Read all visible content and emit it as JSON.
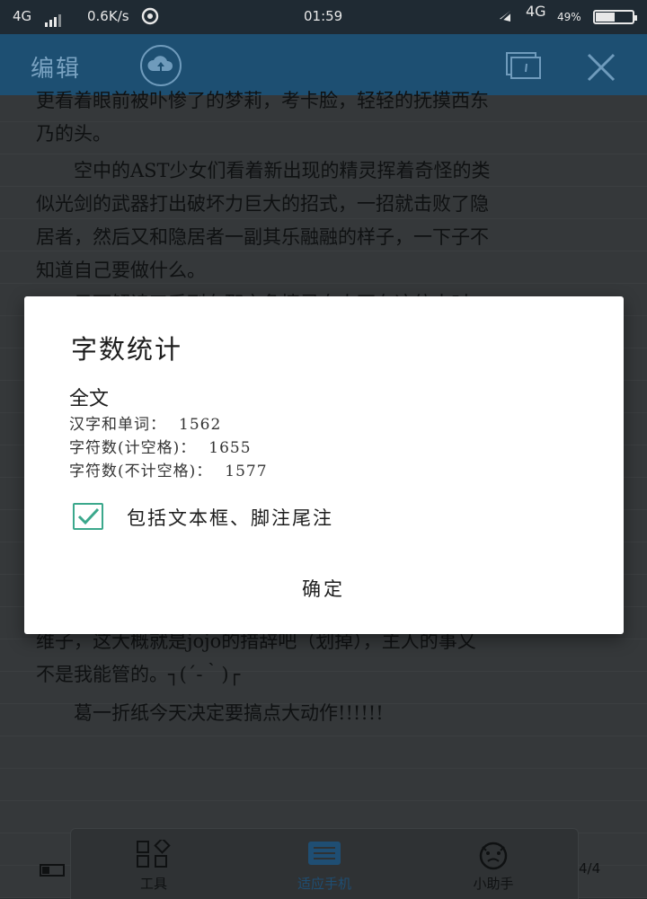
{
  "status_bar": {
    "network_left": "4G",
    "speed": "0.6K/s",
    "time": "01:59",
    "network_right": "4G",
    "battery_text": "49%",
    "battery_level": 0.49
  },
  "app_bar": {
    "title": "编辑",
    "icons": [
      "cloud-upload-icon",
      "duplicate-icon",
      "close-icon"
    ]
  },
  "document": {
    "lines_before": [
      "更看着眼前被卟惨了的梦莉，考卡脸，轻轻的抚摸西东",
      "乃的头。"
    ],
    "paragraph1": [
      "空中的AST少女们看着新出现的精灵挥着奇怪的类",
      "似光剑的武器打出破坏力巨大的招式，一招就击败了隐",
      "居者，然后又和隐居者一副其乐融融的样子，一下子不",
      "知道自己要做什么。"
    ],
    "paragraph1b": "只可解读了系列在那之角情灵自人不在这仿大时",
    "lines_after": [
      "维子，这大概就是jojo的措辞吧（划掉），主人的事又",
      "不是我能管的。┐(´-｀)┌"
    ],
    "closing": "葛一折纸今天决定要搞点大动作!!!!!!"
  },
  "bottom_bar": {
    "tools": [
      {
        "label": "工具",
        "icon": "tools-grid-icon"
      },
      {
        "label": "适应手机",
        "icon": "fit-phone-icon"
      },
      {
        "label": "小助手",
        "icon": "assistant-face-icon"
      }
    ],
    "page_indicator": "4/4"
  },
  "dialog": {
    "title": "字数统计",
    "section": "全文",
    "rows": [
      {
        "label": "汉字和单词：",
        "value": "1562"
      },
      {
        "label": "字符数(计空格)：",
        "value": "1655"
      },
      {
        "label": "字符数(不计空格)：",
        "value": "1577"
      }
    ],
    "checkbox": {
      "label": "包括文本框、脚注尾注",
      "checked": true
    },
    "ok_button": "确定",
    "accent_color": "#3ba88c"
  }
}
